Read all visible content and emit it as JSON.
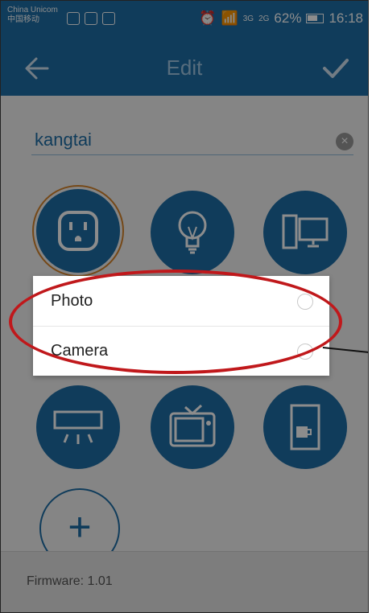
{
  "status_bar": {
    "carrier_line1": "China Unicom",
    "carrier_line2": "中国移动",
    "network_3g": "3G",
    "network_2g": "2G",
    "battery_percent": "62%",
    "time": "16:18"
  },
  "header": {
    "title": "Edit",
    "back_icon": "arrow-left-icon",
    "confirm_icon": "checkmark-icon"
  },
  "name_field": {
    "value": "kangtai",
    "clear_icon": "clear-icon"
  },
  "device_icons": [
    {
      "name": "outlet-icon",
      "selected": true
    },
    {
      "name": "lightbulb-icon",
      "selected": false
    },
    {
      "name": "computer-icon",
      "selected": false
    },
    {
      "name": "air-conditioner-icon",
      "selected": false
    },
    {
      "name": "tv-icon",
      "selected": false
    },
    {
      "name": "coffee-machine-icon",
      "selected": false
    }
  ],
  "add_button": "+",
  "footer": {
    "firmware": "Firmware: 1.01"
  },
  "dialog": {
    "options": [
      {
        "label": "Photo"
      },
      {
        "label": "Camera"
      }
    ]
  },
  "colors": {
    "primary": "#1e6ea7",
    "annotation": "#c0181b",
    "selected_ring": "#d5842b"
  }
}
